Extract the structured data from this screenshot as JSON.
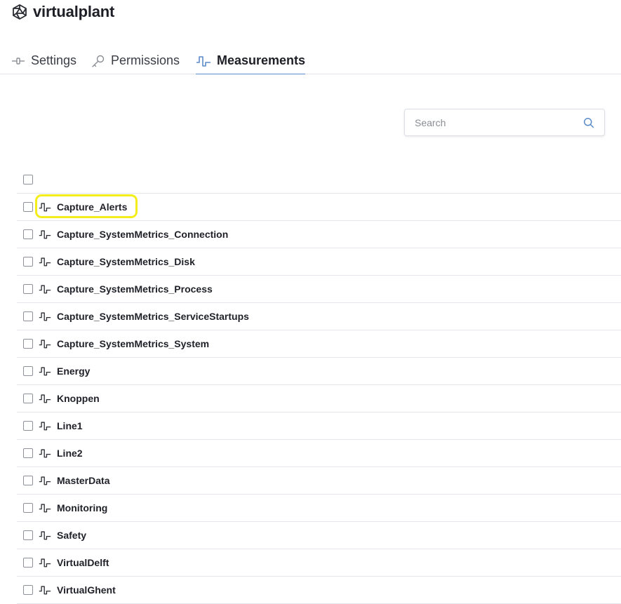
{
  "app": {
    "title": "virtualplant",
    "logo_icon": "polyhedron-icon"
  },
  "tabs": [
    {
      "label": "Settings",
      "icon": "slider-icon",
      "active": false
    },
    {
      "label": "Permissions",
      "icon": "key-icon",
      "active": false
    },
    {
      "label": "Measurements",
      "icon": "waveform-icon",
      "active": true
    }
  ],
  "search": {
    "placeholder": "Search",
    "value": "",
    "icon": "search-icon"
  },
  "measurements": {
    "select_all_checked": false,
    "highlighted": "Capture_Alerts",
    "highlight_color": "#f3ee1a",
    "items": [
      {
        "name": "Capture_Alerts",
        "checked": false
      },
      {
        "name": "Capture_SystemMetrics_Connection",
        "checked": false
      },
      {
        "name": "Capture_SystemMetrics_Disk",
        "checked": false
      },
      {
        "name": "Capture_SystemMetrics_Process",
        "checked": false
      },
      {
        "name": "Capture_SystemMetrics_ServiceStartups",
        "checked": false
      },
      {
        "name": "Capture_SystemMetrics_System",
        "checked": false
      },
      {
        "name": "Energy",
        "checked": false
      },
      {
        "name": "Knoppen",
        "checked": false
      },
      {
        "name": "Line1",
        "checked": false
      },
      {
        "name": "Line2",
        "checked": false
      },
      {
        "name": "MasterData",
        "checked": false
      },
      {
        "name": "Monitoring",
        "checked": false
      },
      {
        "name": "Safety",
        "checked": false
      },
      {
        "name": "VirtualDelft",
        "checked": false
      },
      {
        "name": "VirtualGhent",
        "checked": false
      }
    ]
  },
  "colors": {
    "accent": "#5b8cc9",
    "text": "#1e1f26",
    "border": "#e4e6eb"
  }
}
